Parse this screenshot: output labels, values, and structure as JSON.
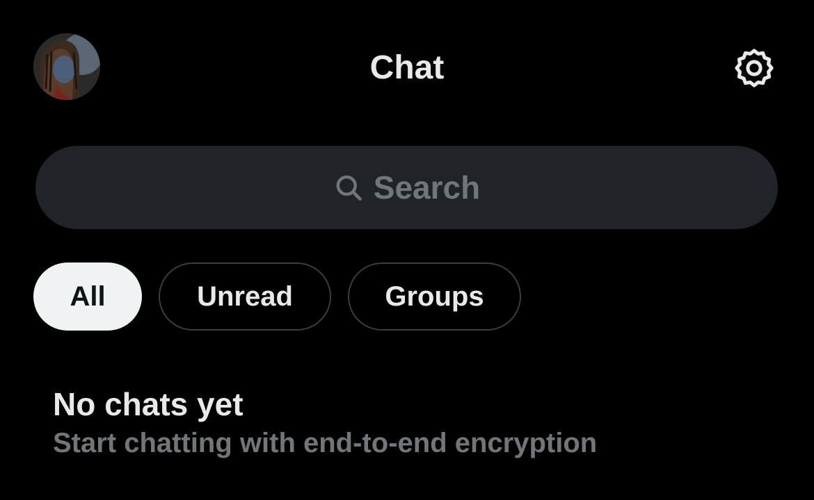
{
  "header": {
    "title": "Chat",
    "avatar_icon": "user-avatar",
    "settings_icon": "gear-icon"
  },
  "search": {
    "placeholder": "Search",
    "icon": "search-icon"
  },
  "filters": [
    {
      "label": "All",
      "selected": true
    },
    {
      "label": "Unread",
      "selected": false
    },
    {
      "label": "Groups",
      "selected": false
    }
  ],
  "empty_state": {
    "title": "No chats yet",
    "subtitle": "Start chatting with end-to-end encryption"
  },
  "colors": {
    "background": "#000000",
    "primary_text": "#e7e9ea",
    "secondary_text": "#71767b",
    "search_background": "#202327",
    "chip_active_background": "#eff3f4",
    "chip_border": "#3a3e42"
  }
}
